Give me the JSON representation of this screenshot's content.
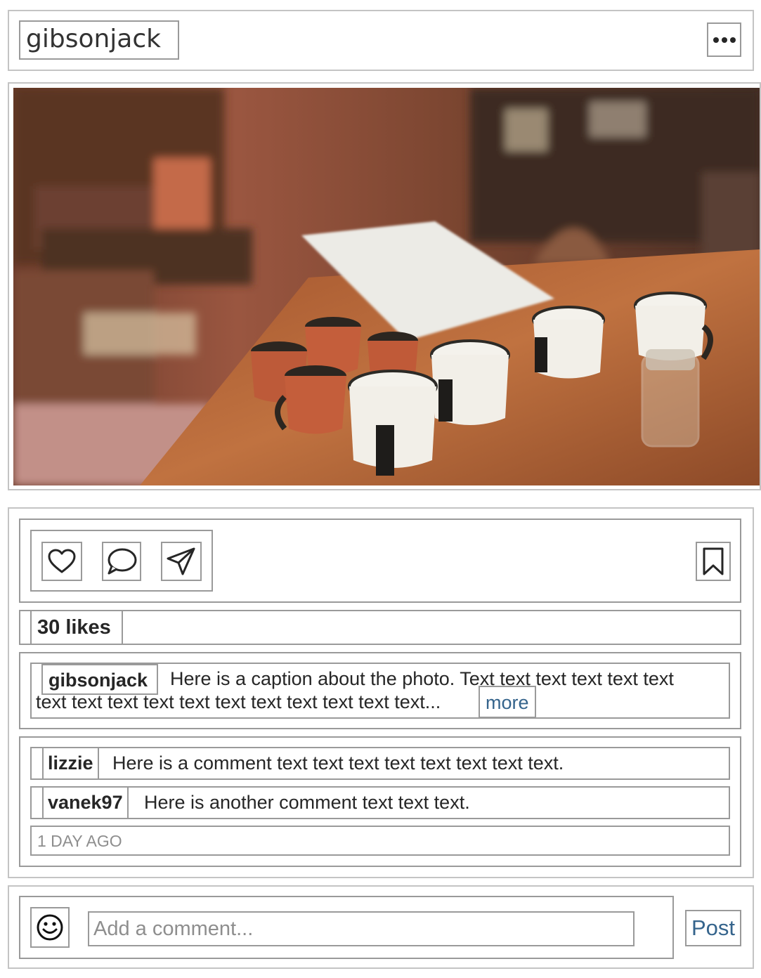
{
  "header": {
    "username": "gibsonjack",
    "more_icon": "more-horizontal-icon"
  },
  "photo": {
    "description_icon": "photo-image",
    "palette": {
      "wall": "#8a4a32",
      "table": "#b0653a",
      "cup_white": "#f2efe8",
      "cup_orange": "#c45e3b"
    }
  },
  "actions": {
    "like_icon": "heart-icon",
    "comment_icon": "speech-bubble-icon",
    "share_icon": "paper-plane-icon",
    "bookmark_icon": "bookmark-icon"
  },
  "likes": "30 likes",
  "caption": {
    "username": "gibsonjack",
    "text_line1": "Here is a caption about the photo. Text text text text text text",
    "text_line2": "text text text text text text text text text text text...",
    "more_label": "more"
  },
  "comments": [
    {
      "username": "lizzie",
      "text": "Here is a comment text text text text text text text text."
    },
    {
      "username": "vanek97",
      "text": "Here is another comment text text text."
    }
  ],
  "timestamp": "1 DAY AGO",
  "footer": {
    "emoji_icon": "smiley-icon",
    "input_placeholder": "Add a comment...",
    "post_label": "Post"
  },
  "colors": {
    "border": "#9a9a9a",
    "link": "#35648c",
    "muted": "#8e8e8e",
    "text": "#262626"
  }
}
